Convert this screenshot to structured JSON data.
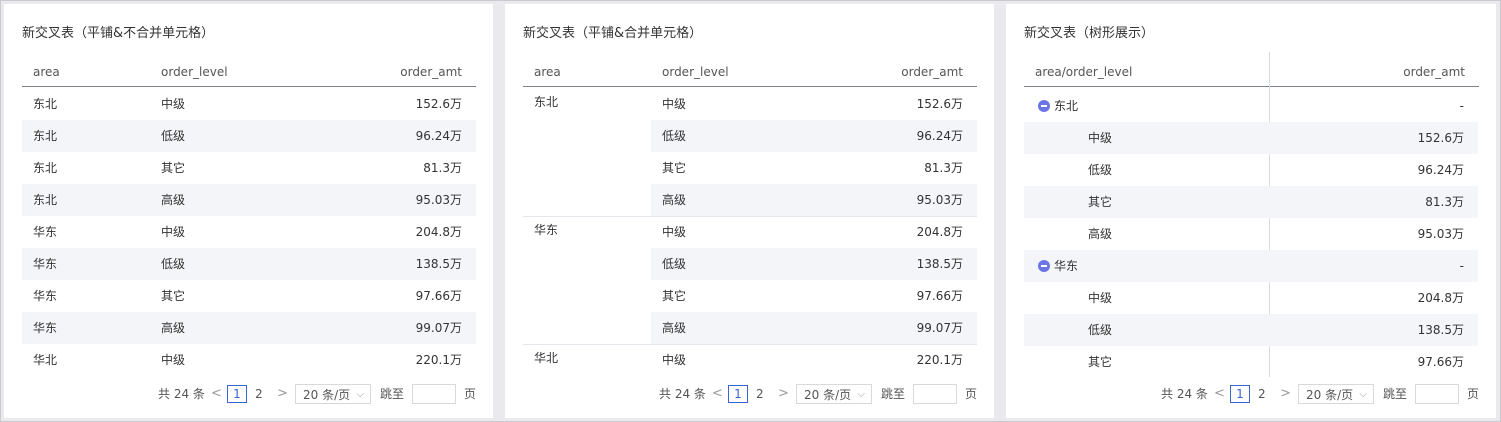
{
  "panels": [
    {
      "title": "新交叉表（平铺&不合并单元格）",
      "headers": [
        "area",
        "order_level",
        "order_amt"
      ],
      "rows": [
        {
          "area": "东北",
          "level": "中级",
          "amt": "152.6万"
        },
        {
          "area": "东北",
          "level": "低级",
          "amt": "96.24万"
        },
        {
          "area": "东北",
          "level": "其它",
          "amt": "81.3万"
        },
        {
          "area": "东北",
          "level": "高级",
          "amt": "95.03万"
        },
        {
          "area": "华东",
          "level": "中级",
          "amt": "204.8万"
        },
        {
          "area": "华东",
          "level": "低级",
          "amt": "138.5万"
        },
        {
          "area": "华东",
          "level": "其它",
          "amt": "97.66万"
        },
        {
          "area": "华东",
          "level": "高级",
          "amt": "99.07万"
        },
        {
          "area": "华北",
          "level": "中级",
          "amt": "220.1万"
        }
      ]
    },
    {
      "title": "新交叉表（平铺&合并单元格）",
      "headers": [
        "area",
        "order_level",
        "order_amt"
      ],
      "groups": [
        {
          "area": "东北",
          "rows": [
            {
              "level": "中级",
              "amt": "152.6万"
            },
            {
              "level": "低级",
              "amt": "96.24万"
            },
            {
              "level": "其它",
              "amt": "81.3万"
            },
            {
              "level": "高级",
              "amt": "95.03万"
            }
          ]
        },
        {
          "area": "华东",
          "rows": [
            {
              "level": "中级",
              "amt": "204.8万"
            },
            {
              "level": "低级",
              "amt": "138.5万"
            },
            {
              "level": "其它",
              "amt": "97.66万"
            },
            {
              "level": "高级",
              "amt": "99.07万"
            }
          ]
        },
        {
          "area": "华北",
          "rows": [
            {
              "level": "中级",
              "amt": "220.1万"
            }
          ]
        }
      ]
    },
    {
      "title": "新交叉表（树形展示）",
      "headers": [
        "area/order_level",
        "order_amt"
      ],
      "tree": [
        {
          "label": "东北",
          "amt": "-",
          "children": [
            {
              "label": "中级",
              "amt": "152.6万"
            },
            {
              "label": "低级",
              "amt": "96.24万"
            },
            {
              "label": "其它",
              "amt": "81.3万"
            },
            {
              "label": "高级",
              "amt": "95.03万"
            }
          ]
        },
        {
          "label": "华东",
          "amt": "-",
          "children": [
            {
              "label": "中级",
              "amt": "204.8万"
            },
            {
              "label": "低级",
              "amt": "138.5万"
            },
            {
              "label": "其它",
              "amt": "97.66万"
            }
          ]
        }
      ]
    }
  ],
  "pagination": {
    "total": "共 24 条",
    "prev": "<",
    "page1": "1",
    "page2": "2",
    "next": ">",
    "page_size": "20 条/页",
    "jump_label": "跳至",
    "page_suffix": "页"
  },
  "colors": {
    "accent": "#3a63d6",
    "tree_icon": "#6b75e3",
    "stripe": "#f4f5f9",
    "header_border": "#7f8290"
  },
  "icons": {
    "prev": "chevron-left-icon",
    "next": "chevron-right-icon",
    "size_dropdown": "chevron-down-icon",
    "tree_collapse": "minus-circle-icon"
  }
}
